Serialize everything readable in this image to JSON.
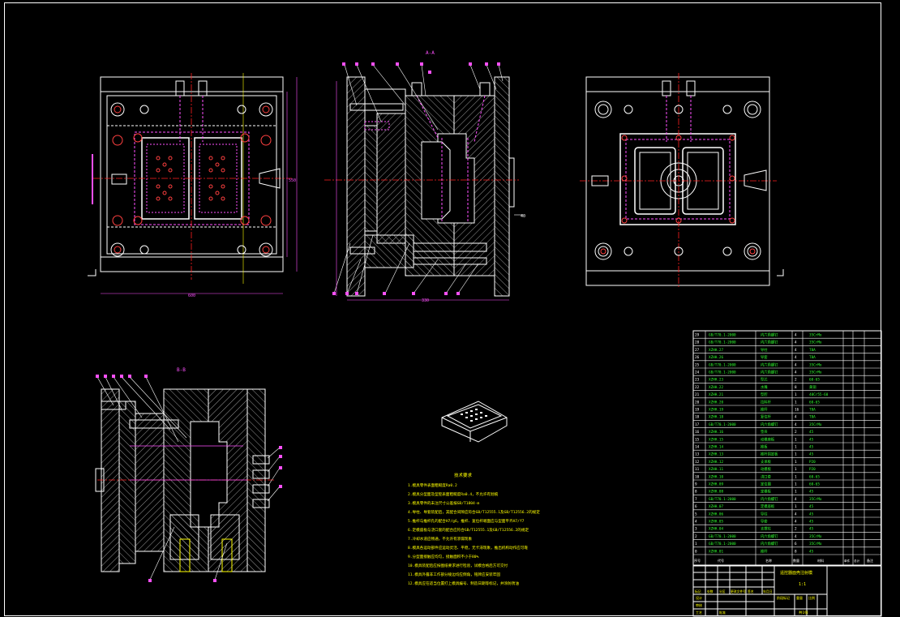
{
  "colors": {
    "background": "#000000",
    "outline": "#ffffff",
    "hatch": "#c8c8c8",
    "center_line": "#ff2020",
    "hidden_line": "#ff50ff",
    "dimension": "#ff50ff",
    "bolt": "#ff4040",
    "table_text": "#30ff30",
    "table_border": "#ffffff",
    "yellow": "#ffff00"
  },
  "section_labels": {
    "aa": "A-A",
    "bb": "B-B"
  },
  "notes": {
    "title": "技术要求",
    "lines": [
      "1.模具零件表面粗糙度Ra0.2",
      "2.模具分型面及型腔表面粗糙度Ra0.4，不允许有划痕",
      "3.模具零件的未注尺寸公差按GB/T1804-m",
      "4.导柱、导套装配后，其配合间隙应符合GB/T12555.1及GB/T12556.2的规定",
      "5.推杆与推杆孔的配合H7/g6，推杆、复位杆端面应与型面平齐H7/f7",
      "6.定模座板与浇口套的配合应符合GB/T12555.1及GB/T12556.2的规定",
      "7.冷却水道应畅通，不允许有渗漏现象",
      "8.模具各运动部件应运动灵活、平稳，无卡滞现象，推出机构动作应可靠",
      "9.分型面接触应均匀，接触面积不小于80%",
      "10.模具装配后应按图纸要求进行检验，试模合格后方可交付",
      "11.模具外露非工作部分棱边均应倒角，铭牌应安装牢固",
      "12.模具应在适当位置打上模具编号、制造日期等标记，并涂防锈油"
    ]
  },
  "bom": {
    "rows": [
      {
        "no": "29",
        "code": "GB/T70.1-2000",
        "name": "内六角螺钉",
        "qty": "4",
        "mat": "35CrMo"
      },
      {
        "no": "28",
        "code": "GB/T70.1-2000",
        "name": "内六角螺钉",
        "qty": "4",
        "mat": "35CrMo"
      },
      {
        "no": "27",
        "code": "XZHH.27",
        "name": "导柱",
        "qty": "4",
        "mat": "T8A"
      },
      {
        "no": "26",
        "code": "XZHH.26",
        "name": "导套",
        "qty": "4",
        "mat": "T8A"
      },
      {
        "no": "25",
        "code": "GB/T70.1-2000",
        "name": "内六角螺钉",
        "qty": "4",
        "mat": "35CrMo"
      },
      {
        "no": "24",
        "code": "GB/T70.1-2000",
        "name": "内六角螺钉",
        "qty": "4",
        "mat": "35CrMo"
      },
      {
        "no": "23",
        "code": "XZHH.23",
        "name": "型芯",
        "qty": "2",
        "mat": "60-65"
      },
      {
        "no": "22",
        "code": "XZHH.22",
        "name": "水嘴",
        "qty": "8",
        "mat": "黄铜"
      },
      {
        "no": "21",
        "code": "XZHH.21",
        "name": "型腔",
        "qty": "1",
        "mat": "40Cr55-60"
      },
      {
        "no": "20",
        "code": "XZHH.20",
        "name": "拉料杆",
        "qty": "1",
        "mat": "60-65"
      },
      {
        "no": "19",
        "code": "XZHH.19",
        "name": "推杆",
        "qty": "16",
        "mat": "T8A"
      },
      {
        "no": "18",
        "code": "XZHH.18",
        "name": "复位杆",
        "qty": "4",
        "mat": "T8A"
      },
      {
        "no": "17",
        "code": "GB/T70.1-2000",
        "name": "内六角螺钉",
        "qty": "4",
        "mat": "35CrMo"
      },
      {
        "no": "16",
        "code": "XZHH.16",
        "name": "垫块",
        "qty": "2",
        "mat": "45"
      },
      {
        "no": "15",
        "code": "XZHH.15",
        "name": "动模座板",
        "qty": "1",
        "mat": "45"
      },
      {
        "no": "14",
        "code": "XZHH.14",
        "name": "推板",
        "qty": "1",
        "mat": "45"
      },
      {
        "no": "13",
        "code": "XZHH.13",
        "name": "推杆固定板",
        "qty": "1",
        "mat": "45"
      },
      {
        "no": "12",
        "code": "XZHH.12",
        "name": "支承板",
        "qty": "1",
        "mat": "P20"
      },
      {
        "no": "11",
        "code": "XZHH.11",
        "name": "动模板",
        "qty": "1",
        "mat": "P20"
      },
      {
        "no": "10",
        "code": "XZHH.10",
        "name": "浇口套",
        "qty": "1",
        "mat": "60-65"
      },
      {
        "no": "9",
        "code": "XZHH.09",
        "name": "定位圈",
        "qty": "1",
        "mat": "60-65"
      },
      {
        "no": "8",
        "code": "XZHH.08",
        "name": "定模板",
        "qty": "1",
        "mat": "45"
      },
      {
        "no": "7",
        "code": "GB/T70.1-2000",
        "name": "内六角螺钉",
        "qty": "4",
        "mat": "35CrMo"
      },
      {
        "no": "6",
        "code": "XZHH.07",
        "name": "定模座板",
        "qty": "1",
        "mat": "45"
      },
      {
        "no": "5",
        "code": "XZHH.06",
        "name": "导柱",
        "qty": "4",
        "mat": "45"
      },
      {
        "no": "4",
        "code": "XZHH.05",
        "name": "导套",
        "qty": "4",
        "mat": "45"
      },
      {
        "no": "3",
        "code": "XZHH.04",
        "name": "支撑柱",
        "qty": "2",
        "mat": "45"
      },
      {
        "no": "2",
        "code": "GB/T70.1-2000",
        "name": "内六角螺钉",
        "qty": "4",
        "mat": "35CrMo"
      },
      {
        "no": "1",
        "code": "GB/T70.1-2000",
        "name": "内六角螺钉",
        "qty": "6",
        "mat": "35CrMo"
      },
      {
        "no": "0",
        "code": "XZHH.01",
        "name": "推杆",
        "qty": "8",
        "mat": "45"
      }
    ],
    "header": {
      "no": "序号",
      "code": "代号",
      "name": "名称",
      "qty": "数量",
      "mat": "材料",
      "w1": "单件",
      "w2": "总计",
      "note": "备注"
    }
  },
  "title_block": {
    "drawing_name": "遥控器面壳注射模",
    "scale": "1:1",
    "sheet": "共1张",
    "labels": [
      "标记",
      "处数",
      "分区",
      "更改文件号",
      "签名",
      "年月日",
      "设计",
      "审核",
      "工艺",
      "批准",
      "阶段标记",
      "重量",
      "比例"
    ]
  },
  "dims": {
    "top_left_width": "600",
    "top_left_height": "550",
    "section_height": "330",
    "side_label": "40"
  }
}
